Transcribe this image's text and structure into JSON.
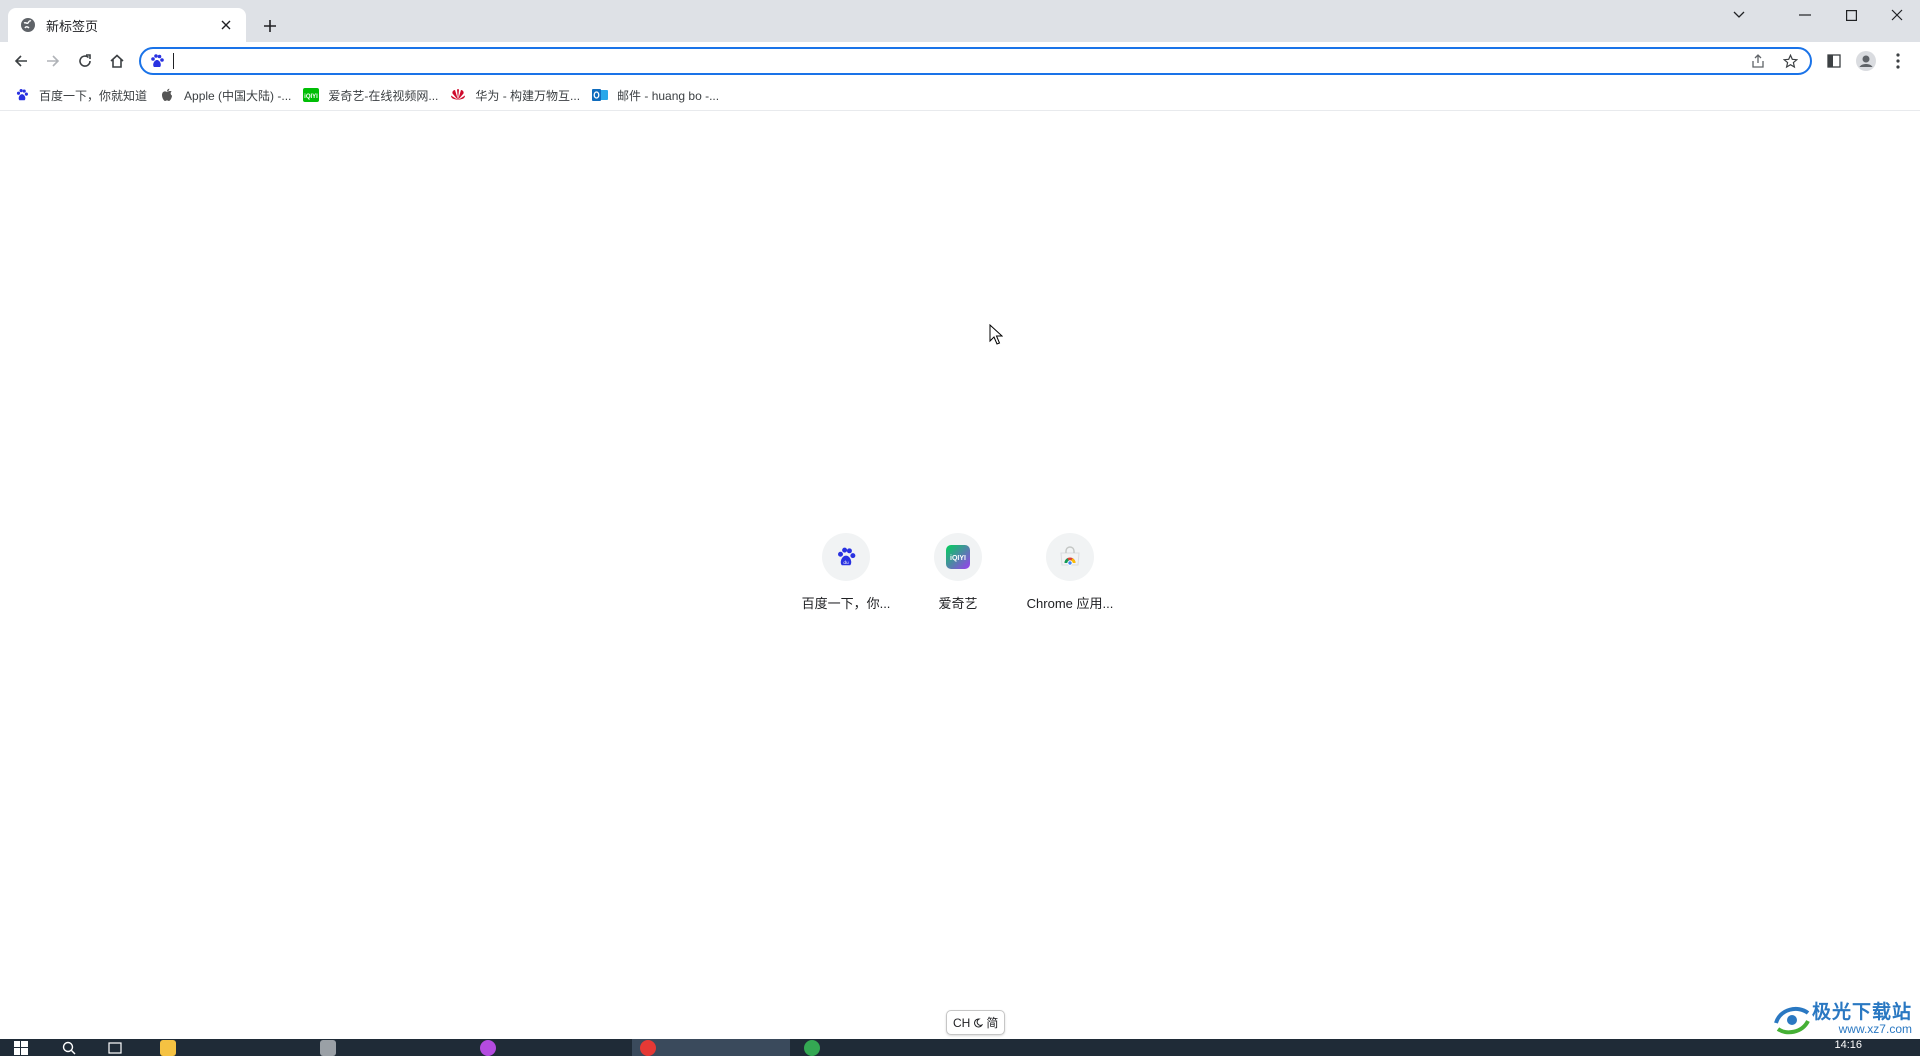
{
  "tab": {
    "title": "新标签页"
  },
  "window_controls": {
    "search_tabs": "search-tabs-icon",
    "minimize": "minimize-icon",
    "maximize": "maximize-icon",
    "close": "close-icon"
  },
  "omnibox": {
    "value": "",
    "placeholder": ""
  },
  "bookmarks": [
    {
      "label": "百度一下，你就知道",
      "icon": "baidu-paw-icon",
      "color": "#2932e1"
    },
    {
      "label": "Apple (中国大陆) -...",
      "icon": "apple-icon",
      "color": "#555555"
    },
    {
      "label": "爱奇艺-在线视频网...",
      "icon": "iqiyi-icon",
      "color": "#00be06"
    },
    {
      "label": "华为 - 构建万物互...",
      "icon": "huawei-icon",
      "color": "#cf0a2c"
    },
    {
      "label": "邮件 - huang bo -...",
      "icon": "outlook-icon",
      "color": "#0f6cbd"
    }
  ],
  "shortcuts": [
    {
      "label": "百度一下，你...",
      "icon": "baidu-paw-icon"
    },
    {
      "label": "爱奇艺",
      "icon": "iqiyi-icon"
    },
    {
      "label": "Chrome 应用...",
      "icon": "chrome-webstore-icon"
    }
  ],
  "ime": {
    "lang": "CH",
    "mode": "简"
  },
  "taskbar": {
    "time": "14:16"
  },
  "watermark": {
    "text": "极光下载站",
    "url": "www.xz7.com"
  },
  "colors": {
    "accent": "#1a73e8",
    "tabstrip": "#dee1e6",
    "taskbar": "#1f2b37"
  }
}
